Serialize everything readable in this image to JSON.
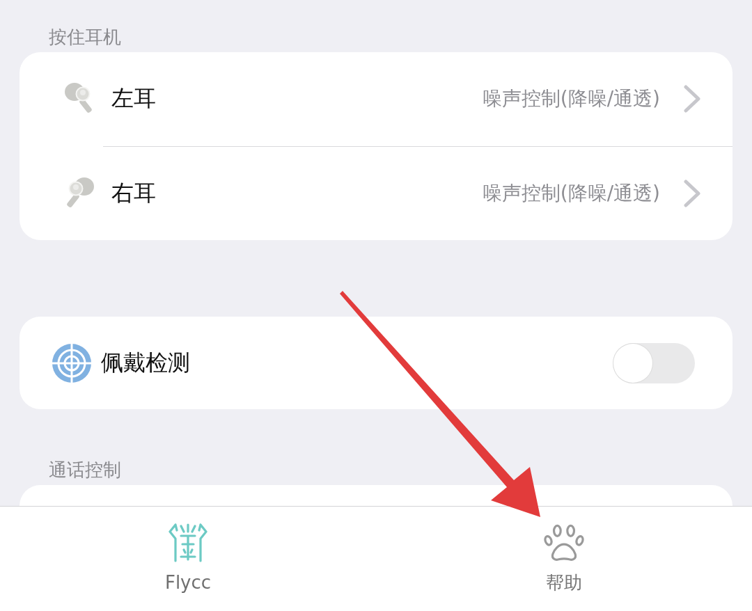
{
  "press_section": {
    "header": "按住耳机",
    "rows": [
      {
        "label": "左耳",
        "value": "噪声控制(降噪/通透)"
      },
      {
        "label": "右耳",
        "value": "噪声控制(降噪/通透)"
      }
    ]
  },
  "wear_detection": {
    "label": "佩戴检测",
    "on": false
  },
  "call_section": {
    "header": "通话控制"
  },
  "tab_bar": {
    "tabs": [
      {
        "label": "Flycc",
        "selected": true
      },
      {
        "label": "帮助",
        "selected": false
      }
    ]
  }
}
